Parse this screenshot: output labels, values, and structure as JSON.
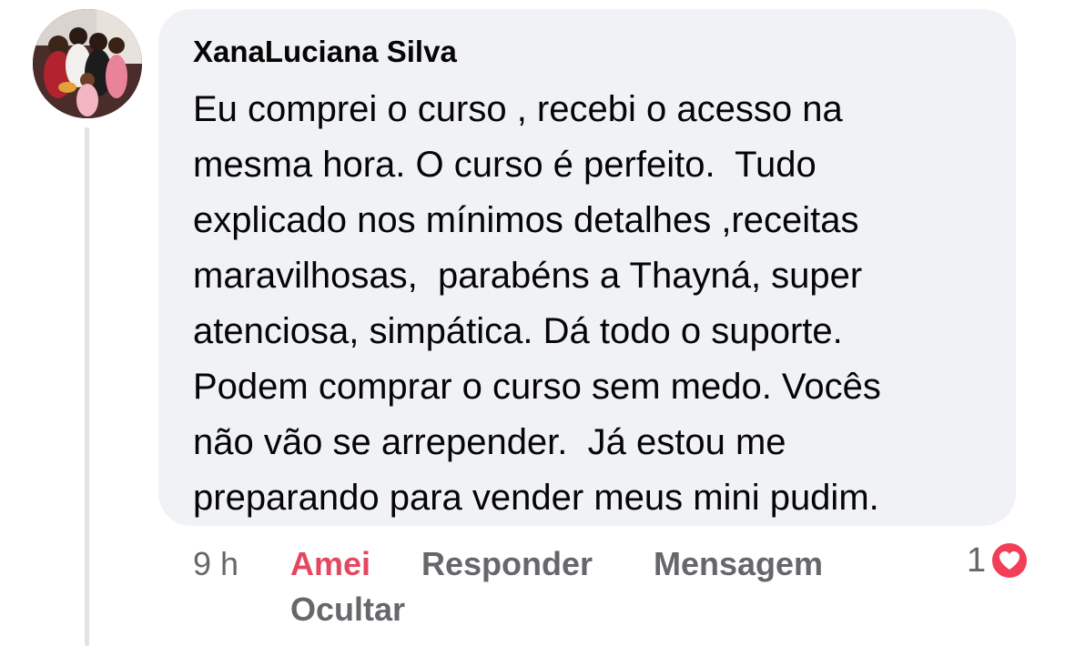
{
  "comment": {
    "author": "XanaLuciana Silva",
    "text_lines": [
      "Eu comprei o curso , recebi o acesso na",
      "mesma hora. O curso é perfeito.  Tudo",
      "explicado nos mínimos detalhes ,receitas",
      "maravilhosas,  parabéns a Thayná, super",
      "atenciosa, simpática. Dá todo o suporte.",
      "Podem comprar o curso sem medo. Vocês",
      "não vão se arrepender.  Já estou me",
      "preparando para vender meus mini pudim."
    ]
  },
  "actions": {
    "time": "9 h",
    "love_label": "Amei",
    "reply_label": "Responder",
    "message_label": "Mensagem",
    "hide_label": "Ocultar"
  },
  "reactions": {
    "count": "1",
    "icon": "heart-icon",
    "color": "#f33e58"
  },
  "colors": {
    "bubble_bg": "#f0f2f5",
    "text": "#050505",
    "secondary_text": "#65676b",
    "love_active": "#e4485f"
  }
}
